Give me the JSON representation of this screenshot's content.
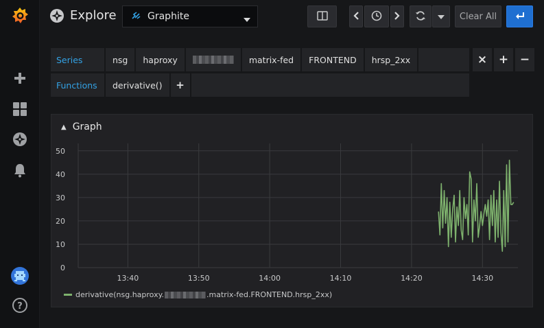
{
  "header": {
    "title": "Explore",
    "datasource": "Graphite",
    "clear_all": "Clear All"
  },
  "query": {
    "series_label": "Series",
    "series_segments": [
      "nsg",
      "haproxy",
      "",
      "matrix-fed",
      "FRONTEND",
      "hrsp_2xx"
    ],
    "functions_label": "Functions",
    "function": "derivative()",
    "add_symbol": "+",
    "remove_symbol": "−",
    "close_symbol": "×"
  },
  "panel": {
    "title": "Graph"
  },
  "legend": {
    "prefix": "derivative(nsg.haproxy.",
    "suffix": ".matrix-fed.FRONTEND.hrsp_2xx)"
  },
  "colors": {
    "accent": "#33a2e5",
    "primary_button": "#1f6fd1",
    "series": "#7eb26d"
  },
  "icons": {
    "logo": "grafana-logo-icon",
    "add": "plus-icon",
    "dashboards": "dashboards-grid-icon",
    "explore": "compass-icon",
    "alerting": "bell-icon",
    "avatar": "user-avatar-icon",
    "help": "help-icon"
  },
  "chart_data": {
    "type": "line",
    "y_ticks": [
      0,
      10,
      20,
      30,
      40,
      50
    ],
    "ylim": [
      0,
      52
    ],
    "x_ticks": [
      "13:40",
      "13:50",
      "14:00",
      "14:10",
      "14:20",
      "14:30"
    ],
    "x_start": "13:33",
    "x_end": "14:35",
    "grid": true,
    "legend_position": "bottom-left",
    "series": [
      {
        "name": "derivative(nsg.haproxy.matrix-fed.FRONTEND.hrsp_2xx)",
        "x": [
          "14:23.8",
          "14:24.0",
          "14:24.2",
          "14:24.4",
          "14:24.6",
          "14:24.8",
          "14:25.0",
          "14:25.2",
          "14:25.4",
          "14:25.6",
          "14:25.8",
          "14:26.0",
          "14:26.2",
          "14:26.4",
          "14:26.6",
          "14:26.8",
          "14:27.0",
          "14:27.2",
          "14:27.4",
          "14:27.6",
          "14:27.8",
          "14:28.0",
          "14:28.2",
          "14:28.4",
          "14:28.6",
          "14:28.8",
          "14:29.0",
          "14:29.2",
          "14:29.4",
          "14:29.6",
          "14:29.8",
          "14:30.0",
          "14:30.2",
          "14:30.4",
          "14:30.6",
          "14:30.8",
          "14:31.0",
          "14:31.2",
          "14:31.4",
          "14:31.6",
          "14:31.8",
          "14:32.0",
          "14:32.2",
          "14:32.4",
          "14:32.6",
          "14:32.8",
          "14:33.0",
          "14:33.2",
          "14:33.4",
          "14:33.6",
          "14:33.8",
          "14:34.0",
          "14:34.2",
          "14:34.4"
        ],
        "values": [
          24,
          14,
          36,
          17,
          33,
          19,
          30,
          9,
          28,
          13,
          25,
          31,
          11,
          26,
          18,
          33,
          16,
          12,
          30,
          21,
          27,
          14,
          41,
          38,
          11,
          29,
          20,
          36,
          13,
          18,
          24,
          18,
          23,
          27,
          22,
          29,
          12,
          31,
          18,
          33,
          11,
          29,
          13,
          37,
          15,
          7,
          33,
          9,
          44,
          11,
          46,
          27,
          27,
          28
        ]
      }
    ]
  }
}
